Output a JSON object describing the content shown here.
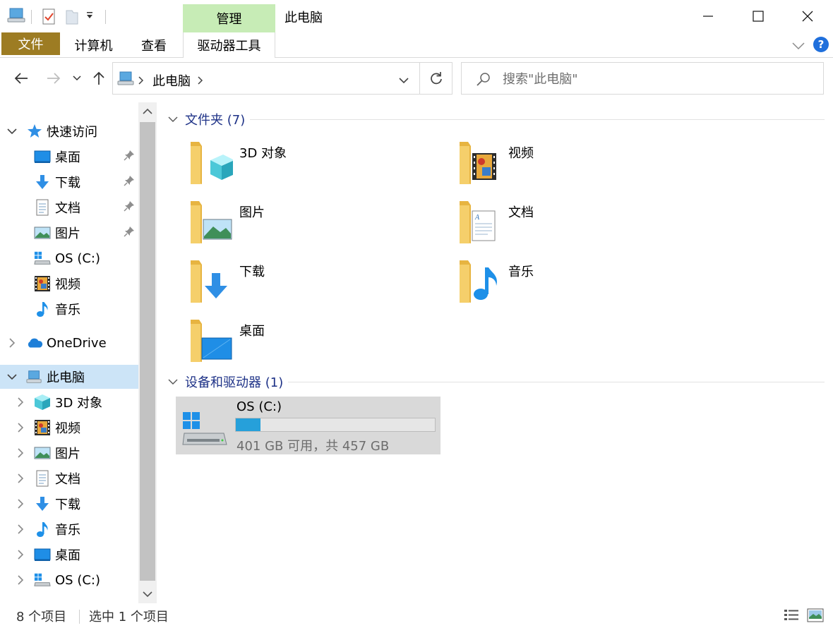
{
  "window": {
    "title": "此电脑",
    "contextual_tab": "管理"
  },
  "ribbon": {
    "tabs": [
      "文件",
      "计算机",
      "查看",
      "驱动器工具"
    ],
    "help": "?"
  },
  "address": {
    "path": "此电脑"
  },
  "search": {
    "placeholder": "搜索\"此电脑\""
  },
  "sidebar": {
    "quick_access": "快速访问",
    "quick_items": [
      {
        "label": "桌面",
        "icon": "desktop-icon",
        "pinned": true
      },
      {
        "label": "下载",
        "icon": "download-icon",
        "pinned": true
      },
      {
        "label": "文档",
        "icon": "document-icon",
        "pinned": true
      },
      {
        "label": "图片",
        "icon": "picture-icon",
        "pinned": true
      },
      {
        "label": "OS (C:)",
        "icon": "drive-icon",
        "pinned": false
      },
      {
        "label": "视频",
        "icon": "video-icon",
        "pinned": false
      },
      {
        "label": "音乐",
        "icon": "music-icon",
        "pinned": false
      }
    ],
    "onedrive": "OneDrive",
    "this_pc": "此电脑",
    "pc_items": [
      {
        "label": "3D 对象",
        "icon": "3d-objects-icon"
      },
      {
        "label": "视频",
        "icon": "video-icon"
      },
      {
        "label": "图片",
        "icon": "picture-icon"
      },
      {
        "label": "文档",
        "icon": "document-icon"
      },
      {
        "label": "下载",
        "icon": "download-icon"
      },
      {
        "label": "音乐",
        "icon": "music-icon"
      },
      {
        "label": "桌面",
        "icon": "desktop-icon"
      },
      {
        "label": "OS (C:)",
        "icon": "drive-icon"
      }
    ]
  },
  "content": {
    "folders_header": "文件夹 (7)",
    "folders": [
      {
        "label": "3D 对象",
        "icon": "3d-objects-folder-icon"
      },
      {
        "label": "视频",
        "icon": "video-folder-icon"
      },
      {
        "label": "图片",
        "icon": "pictures-folder-icon"
      },
      {
        "label": "文档",
        "icon": "documents-folder-icon"
      },
      {
        "label": "下载",
        "icon": "downloads-folder-icon"
      },
      {
        "label": "音乐",
        "icon": "music-folder-icon"
      },
      {
        "label": "桌面",
        "icon": "desktop-folder-icon"
      }
    ],
    "devices_header": "设备和驱动器 (1)",
    "drive": {
      "name": "OS (C:)",
      "free_text": "401 GB 可用，共 457 GB",
      "free_gb": 401,
      "total_gb": 457
    }
  },
  "status": {
    "item_count": "8 个项目",
    "selection": "选中 1 个项目"
  },
  "colors": {
    "file_tab": "#9d7c23",
    "manage_tab": "#c7ecb6",
    "selection": "#cce4f7",
    "group_header": "#1e3287",
    "drive_bar": "#26a0da",
    "folder": "#f5cf6b"
  }
}
